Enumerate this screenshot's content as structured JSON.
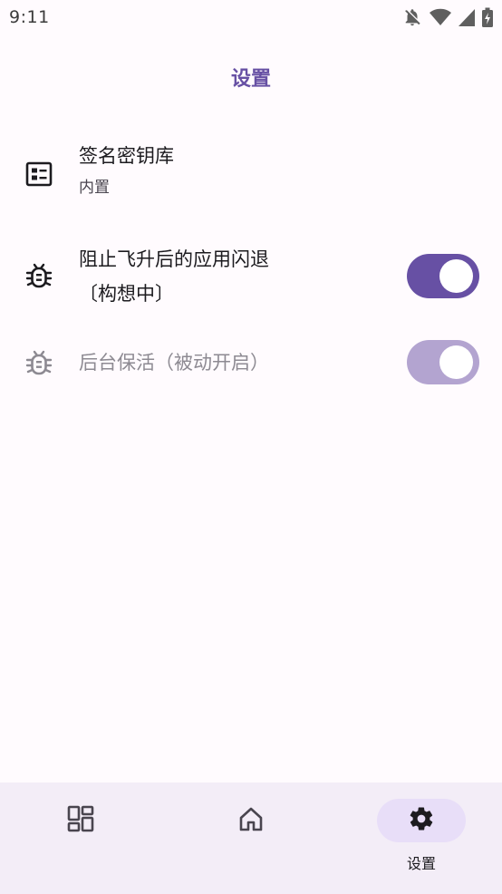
{
  "status_bar": {
    "time": "9:11",
    "icons": [
      "notifications-off-icon",
      "wifi-icon",
      "signal-icon",
      "battery-charging-icon"
    ]
  },
  "header": {
    "title": "设置"
  },
  "settings": {
    "keystore": {
      "title": "签名密钥库",
      "subtitle": "内置",
      "icon": "keystore-card-icon"
    },
    "prevent_crash": {
      "title_line1": "阻止飞升后的应用闪退",
      "title_line2": "〔构想中〕",
      "icon": "bug-icon",
      "enabled": true,
      "switch_on": true
    },
    "keep_alive": {
      "title": "后台保活（被动开启）",
      "icon": "bug-icon",
      "enabled": false,
      "switch_on": true
    }
  },
  "bottom_nav": {
    "items": [
      {
        "name": "dashboard",
        "icon": "dashboard-icon",
        "label": ""
      },
      {
        "name": "home",
        "icon": "home-icon",
        "label": ""
      },
      {
        "name": "settings",
        "icon": "gear-icon",
        "label": "设置",
        "active": true
      }
    ]
  },
  "colors": {
    "primary": "#6750a4",
    "background": "#fffbfe",
    "nav_background": "#f3edf7",
    "nav_active_pill": "#e8def8",
    "switch_disabled": "#b3a4d0"
  }
}
